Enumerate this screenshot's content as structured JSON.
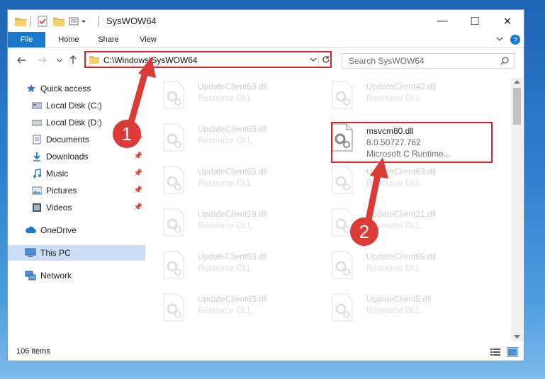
{
  "window": {
    "title": "SysWOW64"
  },
  "window_controls": {
    "minimize": "—",
    "maximize": "☐",
    "close": "✕"
  },
  "ribbon": {
    "tabs": [
      "File",
      "Home",
      "Share",
      "View"
    ]
  },
  "address": {
    "path": "C:\\Windows\\SysWOW64",
    "search_placeholder": "Search SysWOW64"
  },
  "sidebar": {
    "items": [
      {
        "label": "Quick access",
        "icon": "star-icon"
      },
      {
        "label": "Local Disk (C:)",
        "icon": "drive-icon",
        "pinned": true
      },
      {
        "label": "Local Disk (D:)",
        "icon": "drive-icon",
        "pinned": true
      },
      {
        "label": "Documents",
        "icon": "documents-icon",
        "pinned": true
      },
      {
        "label": "Downloads",
        "icon": "downloads-icon",
        "pinned": true
      },
      {
        "label": "Music",
        "icon": "music-icon",
        "pinned": true
      },
      {
        "label": "Pictures",
        "icon": "pictures-icon",
        "pinned": true
      },
      {
        "label": "Videos",
        "icon": "videos-icon",
        "pinned": true
      },
      {
        "label": "OneDrive",
        "icon": "cloud-icon"
      },
      {
        "label": "This PC",
        "icon": "computer-icon",
        "selected": true
      },
      {
        "label": "Network",
        "icon": "network-icon"
      }
    ]
  },
  "files": {
    "left": [
      {
        "name": "UpdateClient63.dll",
        "type": "Resource DLL"
      },
      {
        "name": "UpdateClient63.dll",
        "type": "Resource DLL"
      },
      {
        "name": "UpdateClient65.dll",
        "type": "Resource DLL"
      },
      {
        "name": "UpdateClient19.dll",
        "type": "Resource DLL"
      },
      {
        "name": "UpdateClient63.dll",
        "type": "Resource DLL"
      },
      {
        "name": "UpdateClient63.dll",
        "type": "Resource DLL"
      }
    ],
    "right": [
      {
        "name": "UpdateClient42.dll",
        "type": "Resource DLL"
      },
      {
        "name": "msvcm80.dll",
        "type": "8.0.50727.762",
        "desc": "Microsoft C Runtime..."
      },
      {
        "name": "UpdateClient63.dll",
        "type": "Resource DLL"
      },
      {
        "name": "UpdateClient21.dll",
        "type": "Resource DLL"
      },
      {
        "name": "UpdateClient65.dll",
        "type": "Resource DLL"
      },
      {
        "name": "UpdateClient5.dll",
        "type": "Resource DLL"
      }
    ]
  },
  "status": {
    "item_count": "106 items"
  },
  "annotations": {
    "step1": "1",
    "step2": "2",
    "color": "#dc3a36"
  }
}
